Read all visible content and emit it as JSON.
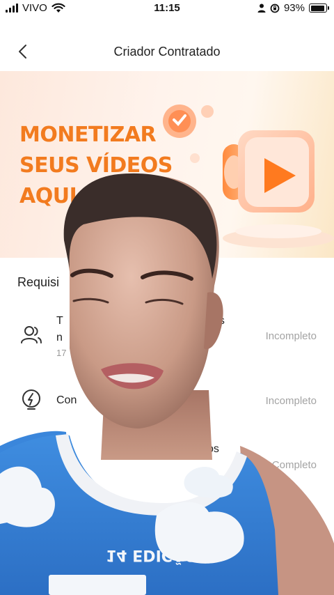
{
  "status_bar": {
    "carrier": "VIVO",
    "time": "11:15",
    "battery": "93%",
    "battery_level": 0.93
  },
  "nav": {
    "title": "Criador Contratado"
  },
  "banner": {
    "line1": "MONETIZAR",
    "line2": "SEUS VÍDEOS",
    "line3": "AQUI"
  },
  "requirements": {
    "title": "Requisi",
    "items": [
      {
        "icon": "users-icon",
        "label_left": "T",
        "label_right": "es",
        "label_line2": "n",
        "sub": "17",
        "status": "Incompleto"
      },
      {
        "icon": "lightning-icon",
        "label": "Con",
        "status": "Incompleto"
      },
      {
        "icon": "public-icon",
        "label_right": "blicos",
        "status": "Completo"
      }
    ]
  },
  "shirt_text": "14 EDIÇÃO"
}
